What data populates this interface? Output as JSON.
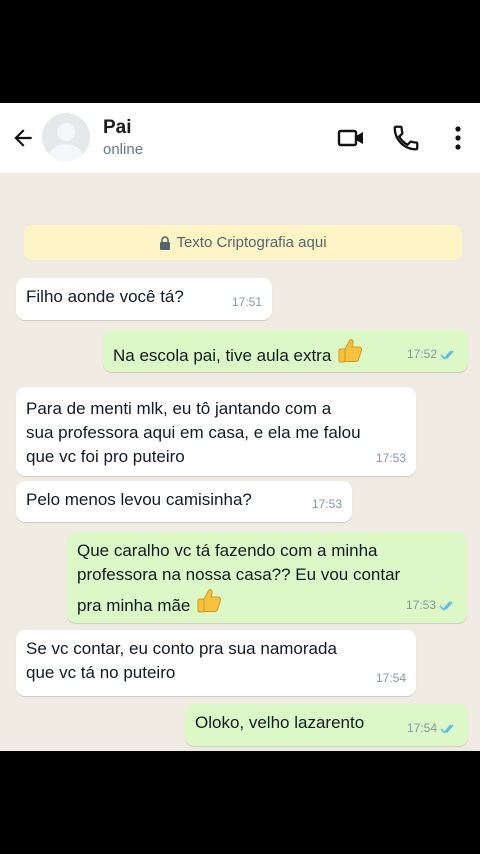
{
  "contact": {
    "name": "Pai",
    "status": "online"
  },
  "encryption_note": "Texto Criptografia aqui",
  "messages": [
    {
      "dir": "in",
      "lines": [
        "Filho aonde você tá?"
      ],
      "time": "17:51"
    },
    {
      "dir": "out",
      "lines": [
        "Na escola pai, tive aula extra"
      ],
      "time": "17:52",
      "emoji": "thumbs-up"
    },
    {
      "dir": "in",
      "lines": [
        "Para de menti mlk, eu tô jantando com a",
        "sua professora aqui em casa, e ela me falou",
        "que vc foi pro puteiro"
      ],
      "time": "17:53"
    },
    {
      "dir": "in",
      "lines": [
        "Pelo menos levou camisinha?"
      ],
      "time": "17:53"
    },
    {
      "dir": "out",
      "lines": [
        "Que caralho vc tá fazendo com a minha",
        "professora na nossa casa?? Eu vou contar",
        "pra minha mãe"
      ],
      "time": "17:53",
      "emoji": "thumbs-up"
    },
    {
      "dir": "in",
      "lines": [
        "Se vc contar, eu conto pra sua namorada",
        "que vc tá no puteiro"
      ],
      "time": "17:54"
    },
    {
      "dir": "out",
      "lines": [
        "Oloko, velho lazarento"
      ],
      "time": "17:54"
    }
  ],
  "colors": {
    "incoming": "#ffffff",
    "outgoing": "#dcf8c6",
    "read_ticks": "#53bdeb",
    "background": "#efeae2"
  }
}
